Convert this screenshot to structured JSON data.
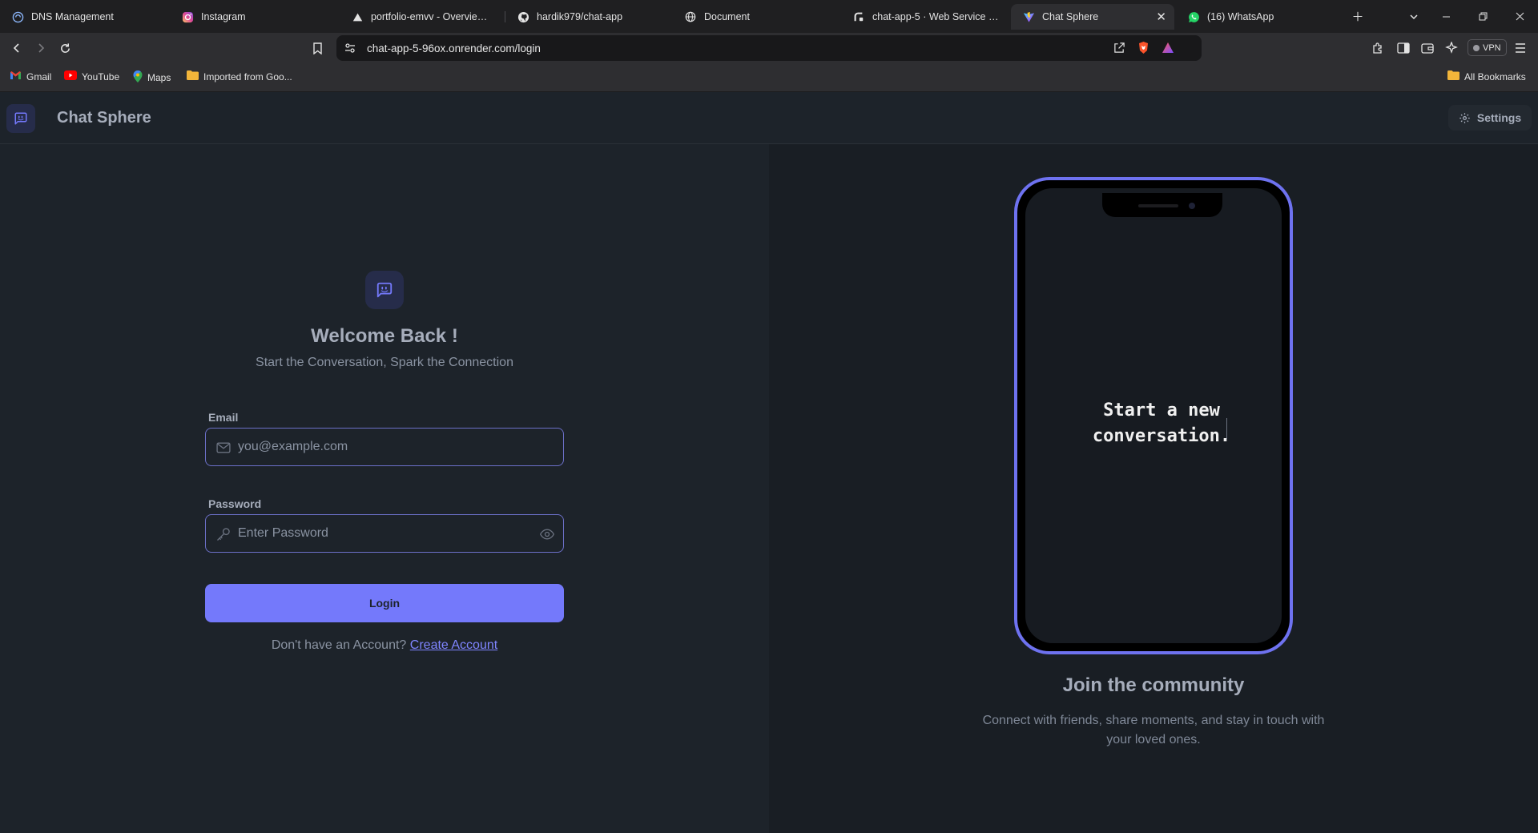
{
  "browser": {
    "tabs": [
      {
        "label": "DNS Management",
        "icon": "dns-icon"
      },
      {
        "label": "Instagram",
        "icon": "instagram-icon"
      },
      {
        "label": "portfolio-emvv - Overview – V",
        "icon": "vercel-icon"
      },
      {
        "label": "hardik979/chat-app",
        "icon": "github-icon"
      },
      {
        "label": "Document",
        "icon": "globe-icon"
      },
      {
        "label": "chat-app-5 · Web Service · Re",
        "icon": "render-icon"
      },
      {
        "label": "Chat Sphere",
        "icon": "vite-icon",
        "active": true
      },
      {
        "label": "(16) WhatsApp",
        "icon": "whatsapp-icon"
      }
    ],
    "url": "chat-app-5-96ox.onrender.com/login",
    "vpn_label": "VPN",
    "bookmarks": [
      {
        "label": "Gmail",
        "icon": "gmail-icon"
      },
      {
        "label": "YouTube",
        "icon": "youtube-icon"
      },
      {
        "label": "Maps",
        "icon": "maps-icon"
      },
      {
        "label": "Imported from Goo...",
        "icon": "folder-icon"
      }
    ],
    "all_bookmarks": "All Bookmarks"
  },
  "app": {
    "brand": "Chat Sphere",
    "settings_label": "Settings"
  },
  "login": {
    "title": "Welcome Back !",
    "subtitle": "Start the Conversation, Spark the Connection",
    "email_label": "Email",
    "email_placeholder": "you@example.com",
    "password_label": "Password",
    "password_placeholder": "Enter Password",
    "login_button": "Login",
    "no_account_text": "Don't have an Account?",
    "create_account_link": "Create Account"
  },
  "promo": {
    "phone_text_line1": "Start a new",
    "phone_text_line2": "conversation.",
    "title": "Join the community",
    "text_line1": "Connect with friends, share moments, and stay in touch with",
    "text_line2": "your loved ones."
  },
  "colors": {
    "accent": "#7479fb",
    "background": "#1d232a",
    "panel": "#191e24"
  }
}
